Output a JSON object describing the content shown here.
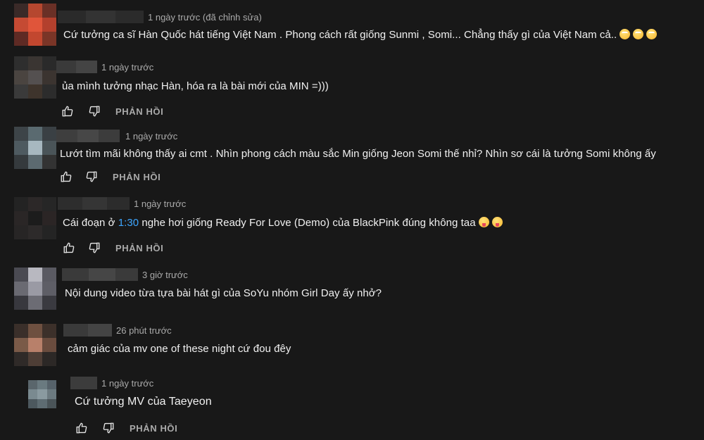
{
  "reply_label": "PHẢN HỒI",
  "comments": [
    {
      "time": "1 ngày trước (đã chỉnh sửa)",
      "text": "Cứ tưởng ca sĩ Hàn Quốc hát tiếng Việt Nam . Phong cách rất giống Sunmi , Somi... Chẳng thấy gì của Việt Nam cả..",
      "emoji_count": 3
    },
    {
      "time": "1 ngày trước",
      "text": "ủa mình tưởng nhạc Hàn, hóa ra là bài mới của MIN =)))"
    },
    {
      "time": "1 ngày trước",
      "text": "Lướt tìm mãi không thấy ai cmt . Nhìn phong cách màu sắc Min giống Jeon Somi thế nhỉ? Nhìn sơ cái là tưởng Somi không ấy"
    },
    {
      "time": "1 ngày trước",
      "text_before": "Cái đoạn ở ",
      "timestamp_link": "1:30",
      "text_after": " nghe hơi giống Ready For Love (Demo)  của BlackPink  đúng không taa",
      "emoji_count": 2
    },
    {
      "time": "3 giờ trước",
      "text": "Nội dung video từa tựa bài hát gì của SoYu nhóm Girl Day ấy nhở?"
    },
    {
      "time": "26 phút trước",
      "text": "cảm giác của mv one of these night cứ đou đêy"
    },
    {
      "time": "1 ngày trước",
      "text": "Cứ tưởng MV của Taeyeon"
    }
  ]
}
